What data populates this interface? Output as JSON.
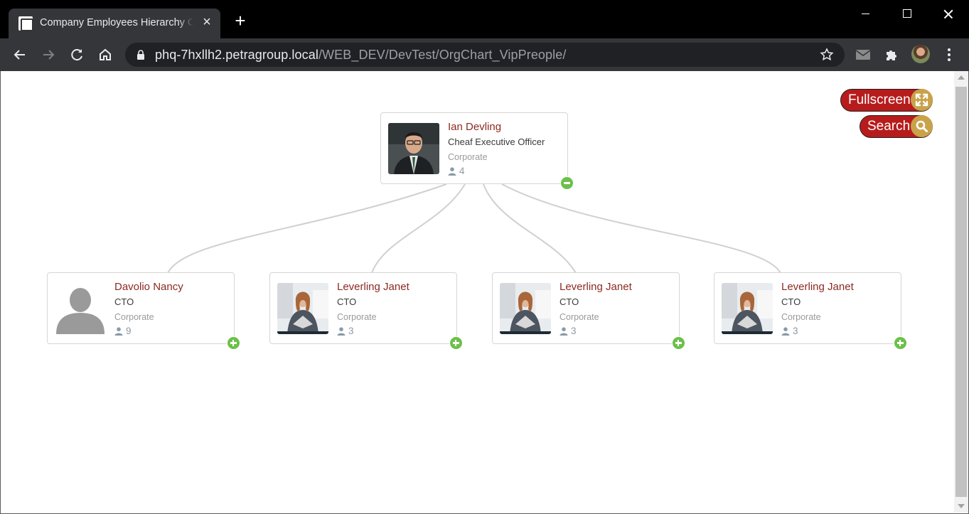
{
  "browser": {
    "tab_title": "Company Employees Hierarchy Chart",
    "url_host": "phq-7hxllh2.petragroup.local",
    "url_path": "/WEB_DEV/DevTest/OrgChart_VipPreople/"
  },
  "actions": {
    "fullscreen_label": "Fullscreen",
    "search_label": "Search"
  },
  "org_chart": {
    "root": {
      "name": "Ian Devling",
      "title": "Cheaf Executive Officer",
      "department": "Corporate",
      "count": "4",
      "expanded": true
    },
    "children": [
      {
        "name": "Davolio Nancy",
        "title": "CTO",
        "department": "Corporate",
        "count": "9",
        "photo": "placeholder-silhouette",
        "expanded": false
      },
      {
        "name": "Leverling Janet",
        "title": "CTO",
        "department": "Corporate",
        "count": "3",
        "photo": "portrait",
        "expanded": false
      },
      {
        "name": "Leverling Janet",
        "title": "CTO",
        "department": "Corporate",
        "count": "3",
        "photo": "portrait",
        "expanded": false
      },
      {
        "name": "Leverling Janet",
        "title": "CTO",
        "department": "Corporate",
        "count": "3",
        "photo": "portrait",
        "expanded": false
      }
    ]
  },
  "colors": {
    "name": "#8b2a22",
    "toggle": "#6cc04a",
    "action_button": "#b71c1c",
    "action_icon": "#c9a24a",
    "connector": "#d0d0d0"
  }
}
